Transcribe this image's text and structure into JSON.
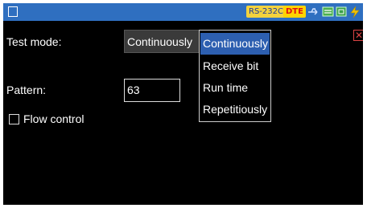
{
  "statusbar": {
    "interface": "RS-232C",
    "mode": "DTE",
    "icons": [
      "usb-icon",
      "network-icon",
      "sd-card-icon",
      "power-icon"
    ]
  },
  "form": {
    "test_mode_label": "Test mode:",
    "test_mode_value": "Continuously",
    "pattern_label": "Pattern:",
    "pattern_value": "63",
    "flow_control_label": "Flow control",
    "flow_control_checked": false
  },
  "dropdown": {
    "options": [
      {
        "label": "Continuously",
        "selected": true
      },
      {
        "label": "Receive bit",
        "selected": false
      },
      {
        "label": "Run time",
        "selected": false
      },
      {
        "label": "Repetitiously",
        "selected": false
      }
    ]
  },
  "colors": {
    "statusbar": "#2f6fc0",
    "selected_option": "#2d5fb0",
    "close": "#dd4444"
  }
}
